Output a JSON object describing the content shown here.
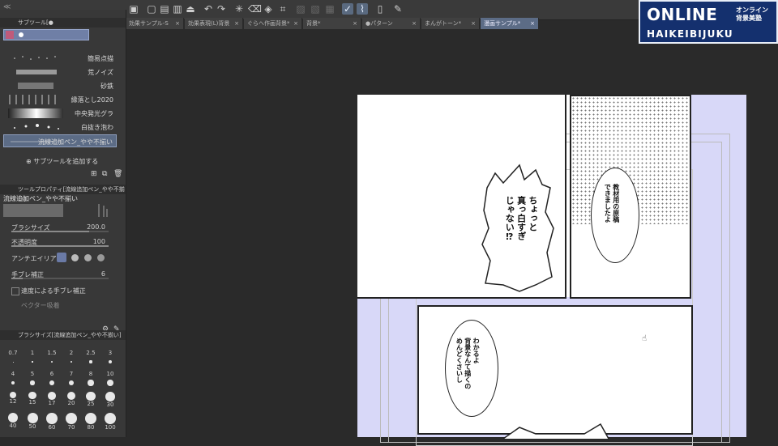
{
  "toolbar": {
    "collapse_glyph": "≪",
    "icons": [
      "camera-icon",
      "new-icon",
      "open-icon",
      "save-icon",
      "undo-icon",
      "redo-icon",
      "transform-icon",
      "clear-icon",
      "fill-icon",
      "crop-icon",
      "select-none-icon",
      "select-invert-icon",
      "lasso-icon",
      "brush-icon",
      "eraser-icon",
      "device-icon",
      "stroke-icon"
    ]
  },
  "logo": {
    "line1": "ONLINE",
    "jp1": "オンライン",
    "jp2": "背景美塾",
    "line2": "HAIKEIBIJUKU"
  },
  "tabs": [
    {
      "label": "効果サンプル-S",
      "close": "×"
    },
    {
      "label": "効果表現(L)背景",
      "close": "×"
    },
    {
      "label": "ぐらへ作画背景*",
      "close": "×"
    },
    {
      "label": "背景*",
      "close": "×"
    },
    {
      "label": "●パターン",
      "close": "×"
    },
    {
      "label": "まんがトーン*",
      "close": "×"
    },
    {
      "label": "漫画サンプル*",
      "close": "×"
    }
  ],
  "subtool_panel": {
    "title": "サブツール[●",
    "items": [
      {
        "label": "簡易点描"
      },
      {
        "label": "荒ノイズ"
      },
      {
        "label": "砂鉄"
      },
      {
        "label": "縁落とし2020"
      },
      {
        "label": "中央発光グラ"
      },
      {
        "label": "白抜き泡わ"
      },
      {
        "label": "流線追加ペン_やや不揃い"
      }
    ],
    "add_label": "サブツールを追加する"
  },
  "tool_property": {
    "title": "ツールプロパティ[流線追加ペン_やや不揃い]",
    "preset_label": "流線追加ペン_やや不揃い",
    "rows": [
      {
        "label": "ブラシサイズ",
        "value": "200.0",
        "pct": 0.8
      },
      {
        "label": "不透明度",
        "value": "100",
        "pct": 1.0
      },
      {
        "label": "アンチエイリアス",
        "value": ""
      },
      {
        "label": "手ブレ補正",
        "value": "6",
        "pct": 0.12
      },
      {
        "label": "速度による手ブレ補正",
        "value": ""
      },
      {
        "label": "ベクター吸着",
        "value": ""
      }
    ]
  },
  "brush_size_panel": {
    "title": "ブラシサイズ[流線追加ペン_やや不揃い]",
    "sizes": [
      "0.7",
      "1",
      "1.5",
      "2",
      "2.5",
      "3",
      "4",
      "5",
      "6",
      "7",
      "8",
      "10",
      "12",
      "15",
      "17",
      "20",
      "25",
      "30",
      "40",
      "50",
      "60",
      "70",
      "80",
      "100"
    ]
  },
  "page": {
    "bubble1": "ちょっと\n真っ白すぎ\nじゃない⁉",
    "bubble2": "教材用の原稿\nできましたよ",
    "bubble3": "わかるよ\n背景なんて描くの\nめんどくさいし"
  }
}
